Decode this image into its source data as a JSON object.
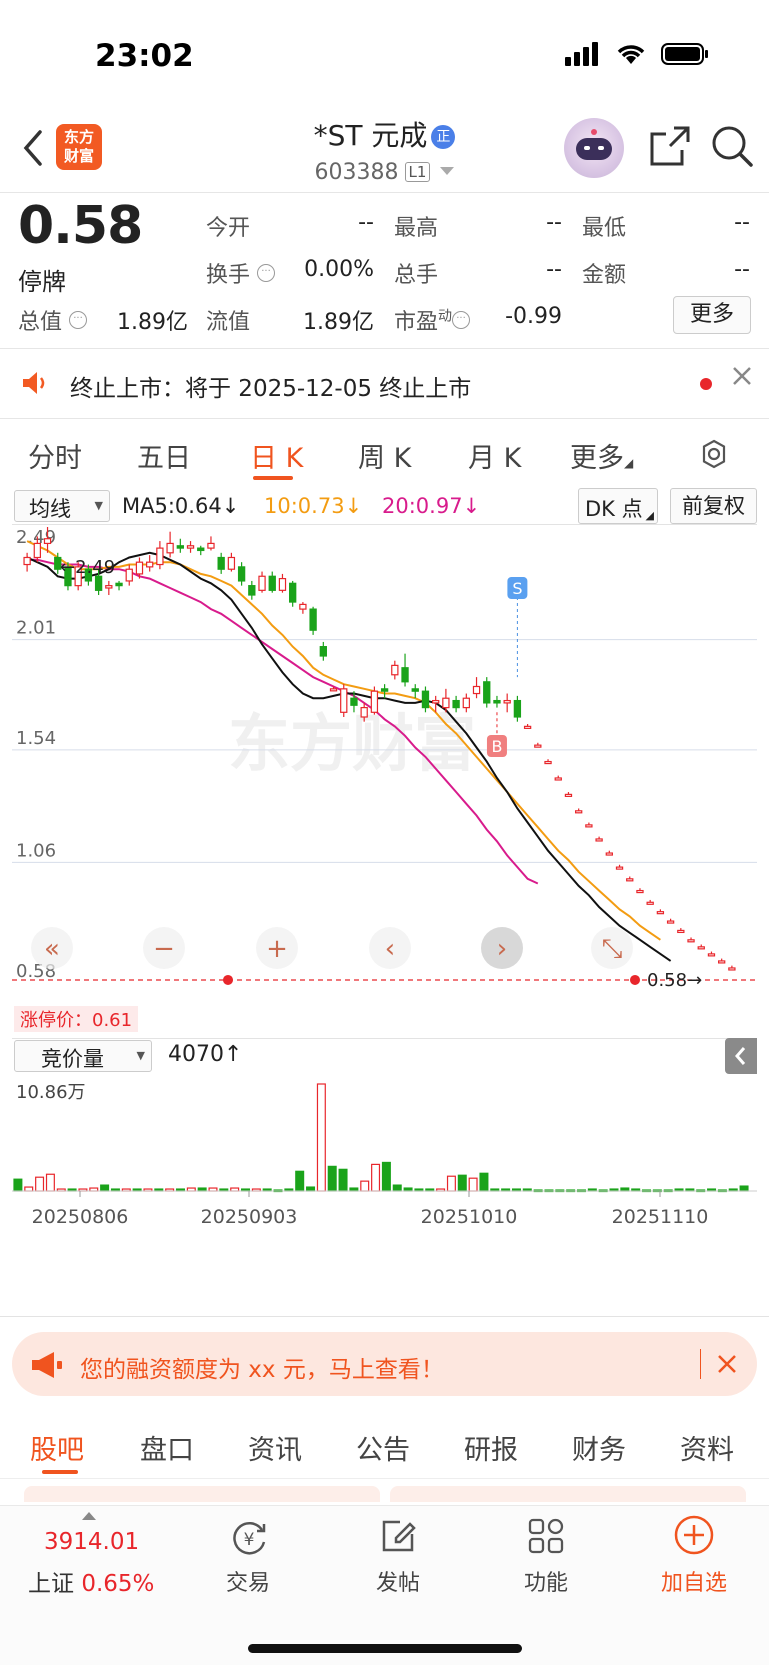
{
  "status_bar": {
    "time": "23:02"
  },
  "header": {
    "logo_text": "东方\n财富",
    "stock_name": "*ST 元成",
    "badge": "正",
    "code": "603388",
    "level": "L1"
  },
  "quote": {
    "price": "0.58",
    "status": "停牌",
    "fields": [
      {
        "label": "今开",
        "value": "--"
      },
      {
        "label": "最高",
        "value": "--"
      },
      {
        "label": "最低",
        "value": "--"
      },
      {
        "label": "换手",
        "value": "0.00%"
      },
      {
        "label": "总手",
        "value": "--"
      },
      {
        "label": "金额",
        "value": "--"
      },
      {
        "label": "总值",
        "value": "1.89亿"
      },
      {
        "label": "流值",
        "value": "1.89亿"
      },
      {
        "label": "市盈",
        "sup": "动",
        "value": "-0.99"
      }
    ],
    "more_label": "更多"
  },
  "notice": {
    "text": "终止上市：将于 2025-12-05 终止上市"
  },
  "period_tabs": [
    "分时",
    "五日",
    "日 K",
    "周 K",
    "月 K",
    "更多"
  ],
  "indicator": {
    "overlay_select": "均线",
    "ma5": "MA5:0.64",
    "ma10": "10:0.73",
    "ma20": "20:0.97",
    "dk_button": "DK 点",
    "adjust_button": "前复权",
    "colors": {
      "ma5": "#111111",
      "ma10": "#f39c12",
      "ma20": "#d81b8c",
      "up": "#e8262b",
      "down": "#1aa31a"
    }
  },
  "chart": {
    "y_labels": [
      "2.49",
      "2.01",
      "1.54",
      "1.06",
      "0.58"
    ],
    "max_label": "2.49",
    "limit_label": "涨停价：0.61",
    "last_label": "0.58",
    "buy_marker": "B",
    "sell_marker": "S",
    "watermark": "东方财富"
  },
  "chart_data": {
    "type": "candlestick",
    "ylim": [
      0.58,
      2.49
    ],
    "x_ticks": [
      "20250806",
      "20250903",
      "20251010",
      "20251110"
    ],
    "candles": [
      [
        2.33,
        2.36,
        2.3,
        2.38
      ],
      [
        2.36,
        2.42,
        2.34,
        2.45
      ],
      [
        2.42,
        2.44,
        2.38,
        2.49
      ],
      [
        2.36,
        2.31,
        2.29,
        2.38
      ],
      [
        2.32,
        2.24,
        2.22,
        2.34
      ],
      [
        2.24,
        2.32,
        2.22,
        2.34
      ],
      [
        2.31,
        2.26,
        2.24,
        2.33
      ],
      [
        2.28,
        2.22,
        2.2,
        2.31
      ],
      [
        2.23,
        2.24,
        2.2,
        2.26
      ],
      [
        2.25,
        2.24,
        2.22,
        2.26
      ],
      [
        2.26,
        2.31,
        2.24,
        2.33
      ],
      [
        2.29,
        2.34,
        2.27,
        2.36
      ],
      [
        2.32,
        2.34,
        2.3,
        2.37
      ],
      [
        2.33,
        2.4,
        2.31,
        2.43
      ],
      [
        2.38,
        2.42,
        2.36,
        2.47
      ],
      [
        2.41,
        2.4,
        2.38,
        2.44
      ],
      [
        2.4,
        2.41,
        2.38,
        2.43
      ],
      [
        2.4,
        2.39,
        2.37,
        2.41
      ],
      [
        2.4,
        2.42,
        2.39,
        2.45
      ],
      [
        2.36,
        2.31,
        2.29,
        2.38
      ],
      [
        2.31,
        2.36,
        2.3,
        2.38
      ],
      [
        2.32,
        2.26,
        2.24,
        2.34
      ],
      [
        2.24,
        2.2,
        2.18,
        2.26
      ],
      [
        2.22,
        2.28,
        2.21,
        2.3
      ],
      [
        2.28,
        2.22,
        2.21,
        2.3
      ],
      [
        2.22,
        2.27,
        2.21,
        2.29
      ],
      [
        2.25,
        2.17,
        2.15,
        2.26
      ],
      [
        2.14,
        2.16,
        2.12,
        2.17
      ],
      [
        2.14,
        2.05,
        2.03,
        2.15
      ],
      [
        1.98,
        1.94,
        1.92,
        2.0
      ],
      [
        1.8,
        1.8,
        1.79,
        1.81
      ],
      [
        1.7,
        1.8,
        1.68,
        1.82
      ],
      [
        1.76,
        1.73,
        1.7,
        1.79
      ],
      [
        1.68,
        1.72,
        1.66,
        1.74
      ],
      [
        1.7,
        1.79,
        1.69,
        1.81
      ],
      [
        1.8,
        1.79,
        1.76,
        1.82
      ],
      [
        1.86,
        1.9,
        1.84,
        1.92
      ],
      [
        1.89,
        1.83,
        1.81,
        1.95
      ],
      [
        1.8,
        1.79,
        1.76,
        1.82
      ],
      [
        1.79,
        1.72,
        1.7,
        1.81
      ],
      [
        1.74,
        1.75,
        1.7,
        1.77
      ],
      [
        1.72,
        1.76,
        1.7,
        1.8
      ],
      [
        1.75,
        1.72,
        1.7,
        1.77
      ],
      [
        1.72,
        1.76,
        1.7,
        1.78
      ],
      [
        1.78,
        1.81,
        1.76,
        1.85
      ],
      [
        1.83,
        1.74,
        1.72,
        1.85
      ],
      [
        1.75,
        1.74,
        1.72,
        1.77
      ],
      [
        1.74,
        1.75,
        1.7,
        1.78
      ],
      [
        1.75,
        1.68,
        1.66,
        1.77
      ],
      [
        1.64,
        1.64,
        1.63,
        1.65
      ],
      [
        1.56,
        1.56,
        1.55,
        1.57
      ],
      [
        1.49,
        1.49,
        1.48,
        1.5
      ],
      [
        1.42,
        1.42,
        1.41,
        1.43
      ],
      [
        1.35,
        1.35,
        1.34,
        1.36
      ],
      [
        1.28,
        1.28,
        1.27,
        1.29
      ],
      [
        1.22,
        1.22,
        1.21,
        1.23
      ],
      [
        1.16,
        1.16,
        1.15,
        1.17
      ],
      [
        1.1,
        1.1,
        1.09,
        1.11
      ],
      [
        1.04,
        1.04,
        1.03,
        1.05
      ],
      [
        0.99,
        0.99,
        0.98,
        1.0
      ],
      [
        0.94,
        0.94,
        0.93,
        0.95
      ],
      [
        0.89,
        0.89,
        0.88,
        0.9
      ],
      [
        0.85,
        0.85,
        0.84,
        0.86
      ],
      [
        0.81,
        0.81,
        0.8,
        0.82
      ],
      [
        0.77,
        0.77,
        0.76,
        0.78
      ],
      [
        0.73,
        0.73,
        0.72,
        0.74
      ],
      [
        0.7,
        0.7,
        0.69,
        0.71
      ],
      [
        0.67,
        0.67,
        0.66,
        0.68
      ],
      [
        0.64,
        0.64,
        0.63,
        0.65
      ],
      [
        0.61,
        0.61,
        0.6,
        0.62
      ]
    ],
    "ma5": [
      2.36,
      2.34,
      2.32,
      2.28,
      2.27,
      2.27,
      2.28,
      2.29,
      2.31,
      2.34,
      2.36,
      2.37,
      2.38,
      2.37,
      2.35,
      2.33,
      2.3,
      2.27,
      2.25,
      2.22,
      2.18,
      2.12,
      2.06,
      1.99,
      1.93,
      1.87,
      1.82,
      1.78,
      1.76,
      1.76,
      1.77,
      1.78,
      1.78,
      1.77,
      1.76,
      1.76,
      1.75,
      1.74,
      1.74,
      1.75,
      1.74,
      1.71,
      1.66,
      1.61,
      1.55,
      1.49,
      1.42,
      1.36,
      1.29,
      1.23,
      1.17,
      1.11,
      1.06,
      1.01,
      0.96,
      0.92,
      0.87,
      0.83,
      0.79,
      0.76,
      0.73,
      0.7,
      0.67,
      0.64
    ],
    "ma10": [
      2.43,
      2.41,
      2.39,
      2.36,
      2.33,
      2.31,
      2.31,
      2.31,
      2.32,
      2.32,
      2.33,
      2.33,
      2.33,
      2.34,
      2.34,
      2.33,
      2.31,
      2.29,
      2.28,
      2.26,
      2.24,
      2.2,
      2.16,
      2.12,
      2.07,
      2.03,
      1.98,
      1.94,
      1.89,
      1.86,
      1.84,
      1.82,
      1.81,
      1.8,
      1.79,
      1.78,
      1.78,
      1.77,
      1.76,
      1.74,
      1.7,
      1.65,
      1.61,
      1.56,
      1.51,
      1.46,
      1.41,
      1.36,
      1.31,
      1.26,
      1.21,
      1.16,
      1.11,
      1.07,
      1.02,
      0.98,
      0.94,
      0.9,
      0.86,
      0.83,
      0.79,
      0.76,
      0.73
    ],
    "ma20": [
      2.35,
      2.35,
      2.34,
      2.33,
      2.33,
      2.33,
      2.32,
      2.32,
      2.31,
      2.31,
      2.3,
      2.28,
      2.27,
      2.25,
      2.23,
      2.21,
      2.19,
      2.17,
      2.14,
      2.12,
      2.09,
      2.06,
      2.03,
      2.0,
      1.97,
      1.94,
      1.91,
      1.88,
      1.85,
      1.83,
      1.81,
      1.79,
      1.77,
      1.74,
      1.71,
      1.67,
      1.64,
      1.6,
      1.55,
      1.51,
      1.46,
      1.41,
      1.36,
      1.31,
      1.26,
      1.2,
      1.15,
      1.09,
      1.04,
      0.99,
      0.97
    ],
    "volume_max_label": "10.86万",
    "volume": [
      1.2,
      0.4,
      1.4,
      1.7,
      0.2,
      0.2,
      0.2,
      0.3,
      0.6,
      0.2,
      0.2,
      0.2,
      0.2,
      0.2,
      0.2,
      0.2,
      0.3,
      0.3,
      0.3,
      0.2,
      0.3,
      0.2,
      0.2,
      0.2,
      0.1,
      0.2,
      2.0,
      0.4,
      10.86,
      2.5,
      2.2,
      0.3,
      1.0,
      2.7,
      2.9,
      0.6,
      0.3,
      0.2,
      0.2,
      0.2,
      1.5,
      1.6,
      1.3,
      1.8,
      0.2,
      0.2,
      0.2,
      0.2,
      0.1,
      0.1,
      0.1,
      0.1,
      0.1,
      0.2,
      0.1,
      0.2,
      0.3,
      0.2,
      0.1,
      0.1,
      0.1,
      0.2,
      0.2,
      0.1,
      0.2,
      0.1,
      0.2,
      0.5
    ],
    "volume_up": [
      false,
      true,
      true,
      true,
      true,
      false,
      true,
      true,
      false,
      false,
      true,
      false,
      true,
      false,
      true,
      false,
      true,
      false,
      true,
      false,
      true,
      false,
      true,
      false,
      false,
      false,
      false,
      false,
      true,
      false,
      false,
      false,
      true,
      true,
      false,
      false,
      false,
      false,
      false,
      true,
      true,
      false,
      true,
      false,
      false,
      false,
      false,
      false,
      false,
      false,
      false,
      false,
      false,
      false,
      false,
      false,
      false,
      false,
      false,
      false,
      false,
      false,
      false,
      false,
      false,
      false,
      false,
      false
    ]
  },
  "volume_panel": {
    "select": "竞价量",
    "value": "4070"
  },
  "promo": {
    "text": "您的融资额度为 xx 元，马上查看！"
  },
  "bottom_tabs": [
    "股吧",
    "盘口",
    "资讯",
    "公告",
    "研报",
    "财务",
    "资料"
  ],
  "bottom_bar": {
    "index_value": "3914.01",
    "index_name": "上证",
    "index_change": "0.65%",
    "items": [
      {
        "label": "交易",
        "icon": "trade-icon"
      },
      {
        "label": "发帖",
        "icon": "post-icon"
      },
      {
        "label": "功能",
        "icon": "apps-icon"
      },
      {
        "label": "加自选",
        "icon": "add-watch-icon"
      }
    ]
  }
}
